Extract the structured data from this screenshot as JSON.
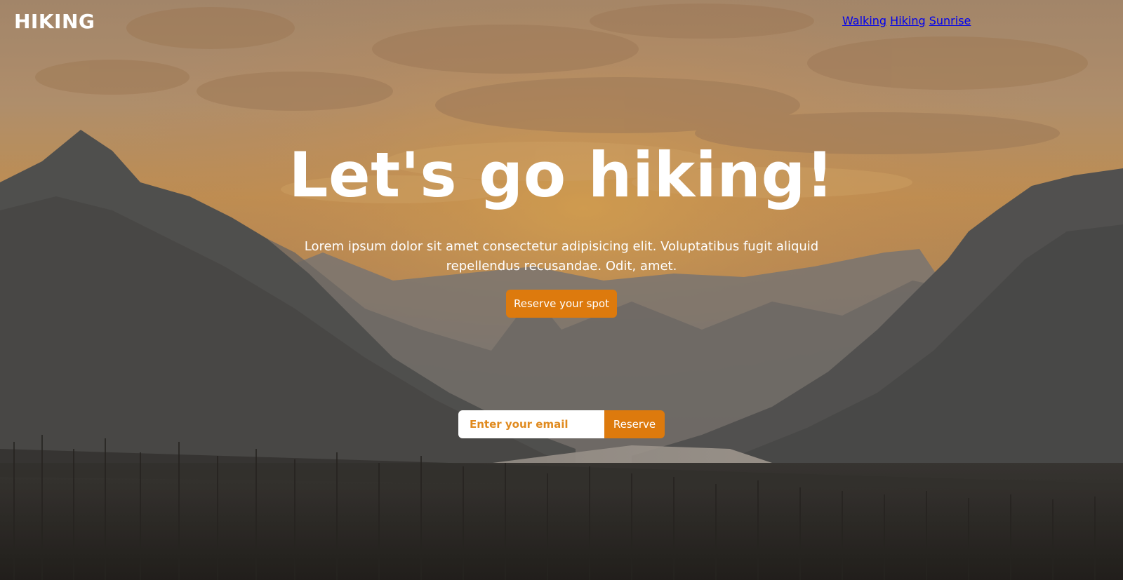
{
  "header": {
    "logo": "HIKING",
    "nav": [
      {
        "label": "Walking"
      },
      {
        "label": "Hiking"
      },
      {
        "label": "Sunrise"
      }
    ]
  },
  "hero": {
    "title": "Let's go hiking!",
    "subtitle": "Lorem ipsum dolor sit amet consectetur adipisicing elit. Voluptatibus fugit aliquid repellendus recusandae. Odit, amet.",
    "cta_label": "Reserve your spot"
  },
  "signup": {
    "email_placeholder": "Enter your email",
    "button_label": "Reserve"
  },
  "colors": {
    "accent": "#dd7a0d",
    "text": "#ffffff"
  }
}
